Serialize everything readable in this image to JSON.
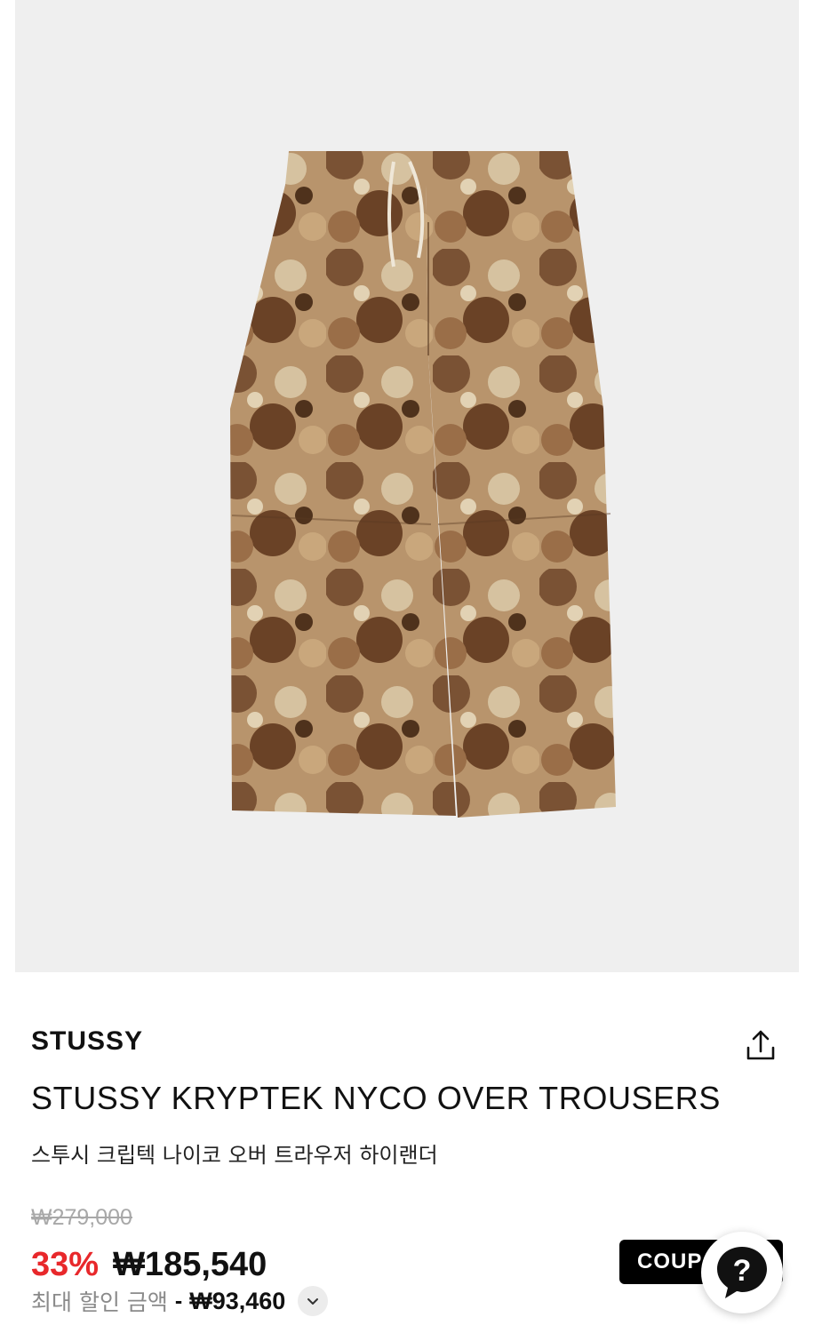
{
  "product": {
    "brand": "STUSSY",
    "name": "STUSSY KRYPTEK NYCO OVER TROUSERS",
    "name_ko": "스투시 크립텍 나이코 오버 트라우저 하이랜더"
  },
  "price": {
    "original": "₩279,000",
    "discount": "33%",
    "sale": "₩185,540",
    "max_label": "최대 할인 금액",
    "max_sep": "-",
    "max_amount": "₩93,460"
  },
  "actions": {
    "coupon_label": "COUP"
  },
  "icons": {
    "share": "share-icon",
    "expand": "chevron-down-icon",
    "help": "question-icon"
  },
  "colors": {
    "discount": "#e8282b",
    "image_bg": "#efefef"
  }
}
